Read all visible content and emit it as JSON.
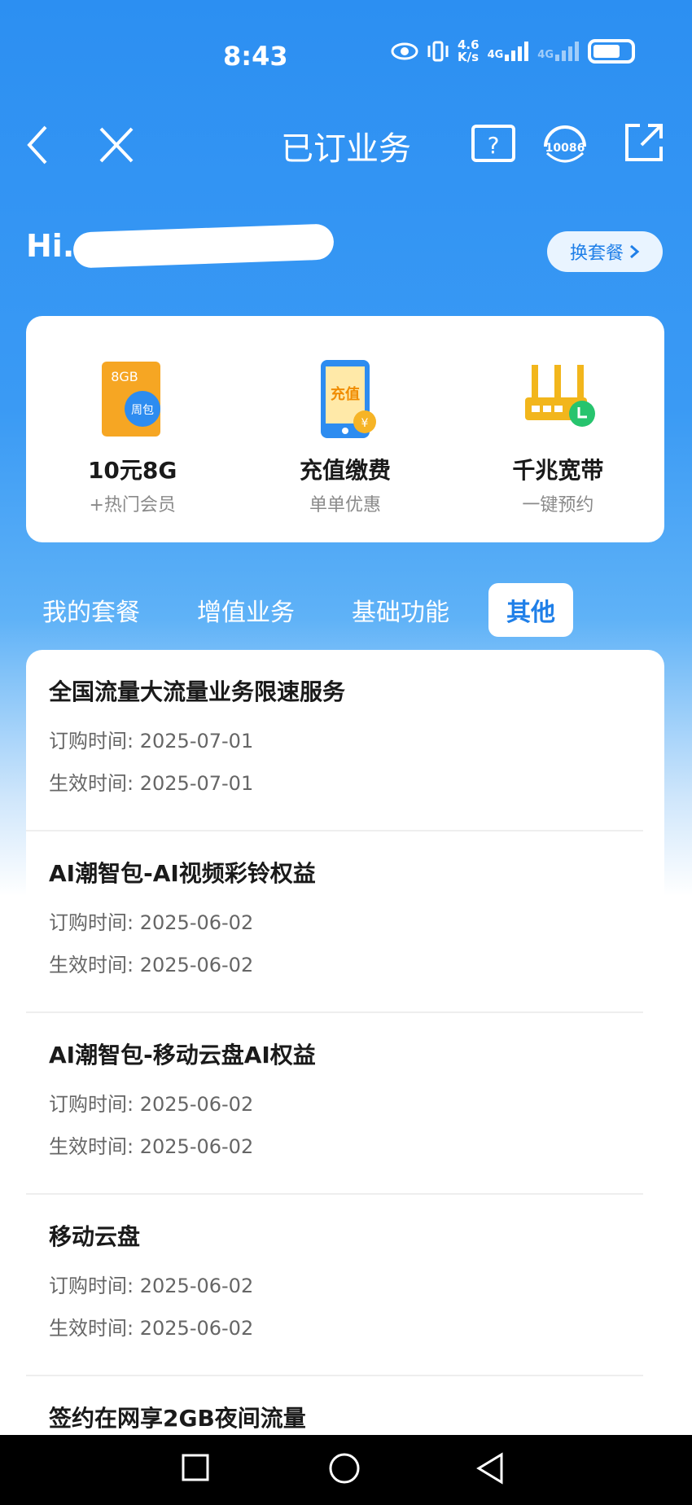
{
  "status_bar": {
    "time": "8:43",
    "net_speed_top": "4.6",
    "net_speed_bottom": "K/s",
    "net_type_1": "4G",
    "net_type_2": "4G",
    "battery": "battery-icon"
  },
  "navbar": {
    "title": "已订业务",
    "back_icon": "chevron-left-icon",
    "close_icon": "close-icon",
    "help_icon": "question-icon",
    "service_icon": "customer-service-icon",
    "service_number": "10086",
    "share_icon": "share-icon"
  },
  "greeting": {
    "text": "Hi. 1",
    "switch_label": "换套餐"
  },
  "quick_actions": [
    {
      "icon": "data-package-icon",
      "icon_top": "8GB",
      "icon_badge": "周包",
      "title": "10元8G",
      "subtitle": "+热门会员"
    },
    {
      "icon": "recharge-icon",
      "icon_text": "充值",
      "icon_coin": "¥",
      "title": "充值缴费",
      "subtitle": "单单优惠"
    },
    {
      "icon": "router-icon",
      "title": "千兆宽带",
      "subtitle": "一键预约"
    }
  ],
  "tabs": [
    {
      "label": "我的套餐",
      "active": false
    },
    {
      "label": "增值业务",
      "active": false
    },
    {
      "label": "基础功能",
      "active": false
    },
    {
      "label": "其他",
      "active": true
    }
  ],
  "services": [
    {
      "name": "全国流量大流量业务限速服务",
      "order_label": "订购时间:",
      "order_date": "2025-07-01",
      "effective_label": "生效时间:",
      "effective_date": "2025-07-01"
    },
    {
      "name": "AI潮智包-AI视频彩铃权益",
      "order_label": "订购时间:",
      "order_date": "2025-06-02",
      "effective_label": "生效时间:",
      "effective_date": "2025-06-02"
    },
    {
      "name": "AI潮智包-移动云盘AI权益",
      "order_label": "订购时间:",
      "order_date": "2025-06-02",
      "effective_label": "生效时间:",
      "effective_date": "2025-06-02"
    },
    {
      "name": "移动云盘",
      "order_label": "订购时间:",
      "order_date": "2025-06-02",
      "effective_label": "生效时间:",
      "effective_date": "2025-06-02"
    },
    {
      "name": "签约在网享2GB夜间流量",
      "order_label": "",
      "order_date": "",
      "effective_label": "",
      "effective_date": ""
    }
  ],
  "colors": {
    "accent": "#1f7fe8",
    "header_blue": "#2c8ff2",
    "orange": "#f6a623",
    "router_yellow": "#f2b61c",
    "green": "#27c46e"
  }
}
